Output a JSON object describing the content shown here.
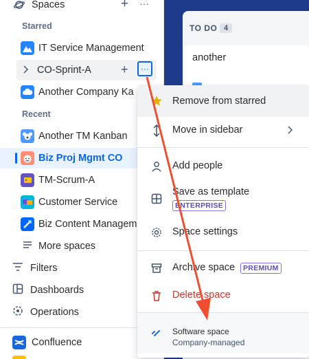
{
  "sidebar": {
    "spaces_label": "Spaces",
    "add_symbol": "+",
    "more_symbol": "···",
    "starred_label": "Starred",
    "recent_label": "Recent",
    "starred": [
      {
        "label": "IT Service Management",
        "icon": "mountain-icon",
        "color": "#2684ff"
      },
      {
        "label": "CO-Sprint-A",
        "icon": "chevron-right-icon"
      },
      {
        "label": "Another Company Ka",
        "icon": "cloud-icon",
        "color": "#2684ff"
      }
    ],
    "recent": [
      {
        "label": "Another TM Kanban",
        "icon": "koala-icon",
        "color": "#4c9aff"
      },
      {
        "label": "Biz Proj Mgmt CO",
        "icon": "face-icon",
        "color": "#ff8f73"
      },
      {
        "label": "TM-Scrum-A",
        "icon": "tag-icon",
        "color": "#6554c0"
      },
      {
        "label": "Customer Service",
        "icon": "chat-icon",
        "color": "#00b8d9"
      },
      {
        "label": "Biz Content Managem",
        "icon": "rocket-icon",
        "color": "#0065ff"
      }
    ],
    "more_spaces": "More spaces",
    "nav": [
      {
        "label": "Filters"
      },
      {
        "label": "Dashboards"
      },
      {
        "label": "Operations"
      }
    ],
    "confluence": "Confluence"
  },
  "board": {
    "column_title": "TO DO",
    "column_count": "4",
    "card_title": "another"
  },
  "menu": {
    "items": [
      {
        "label": "Remove from starred"
      },
      {
        "label": "Move in sidebar"
      },
      {
        "label": "Add people"
      },
      {
        "label": "Save as template",
        "badge": "ENTERPRISE"
      },
      {
        "label": "Space settings"
      },
      {
        "label": "Archive space",
        "badge": "PREMIUM"
      },
      {
        "label": "Delete space"
      }
    ],
    "footer_title": "Software space",
    "footer_sub": "Company-managed"
  },
  "colors": {
    "accent": "#0c66e4",
    "danger": "#c9372c",
    "arrow": "#f04e30",
    "star": "#e2b203"
  }
}
